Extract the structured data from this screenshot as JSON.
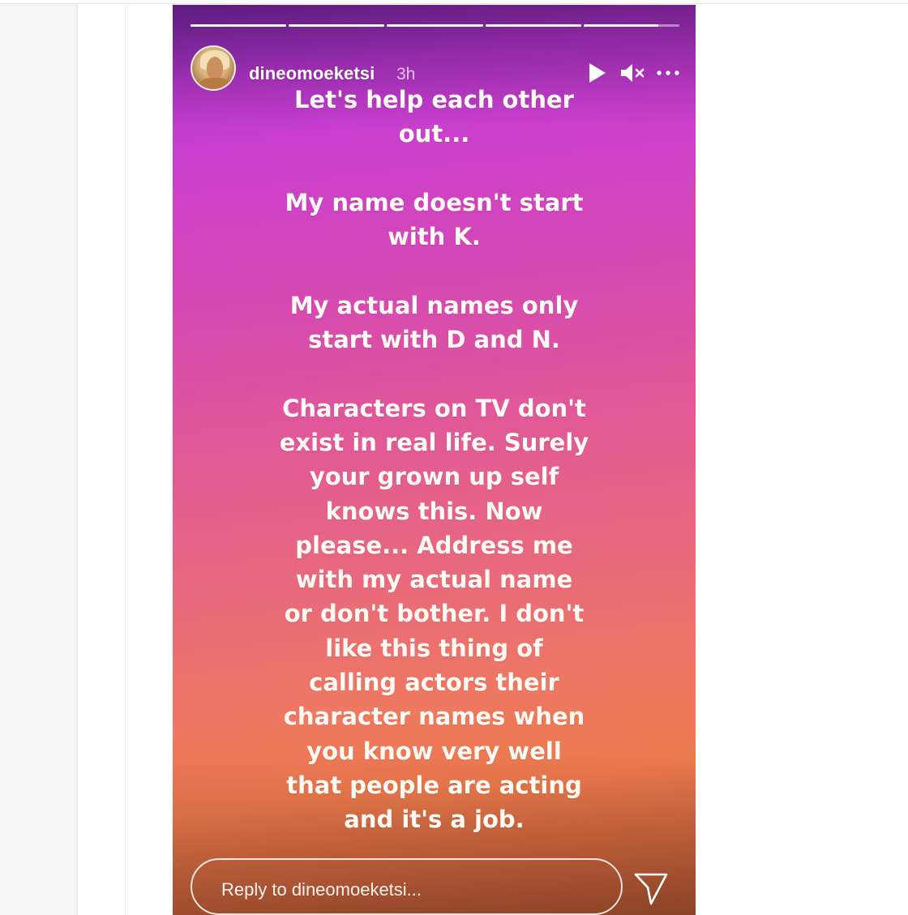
{
  "story": {
    "progress": [
      1,
      1,
      1,
      1,
      0.78
    ],
    "username": "dineomoeketsi",
    "time_ago": "3h",
    "controls": {
      "play_icon": "play-icon",
      "mute_icon": "muted-speaker-icon",
      "more_icon": "more-options-icon"
    },
    "text": {
      "p1": "Let's help each other\nout...",
      "p2": "My name doesn't start\nwith K.",
      "p3": "My actual names only\nstart with D and N.",
      "p4": "Characters on TV don't\nexist in real life. Surely\nyour grown up self\nknows this. Now\nplease... Address me\nwith my actual name\nor don't bother. I don't\nlike this thing of\ncalling actors their\ncharacter names when\nyou know very well\nthat people are acting\nand it's a job."
    },
    "reply": {
      "placeholder": "Reply to dineomoeketsi...",
      "value": ""
    },
    "send_icon": "paper-plane-icon",
    "colors": {
      "gradient_top": "#c93fcf",
      "gradient_mid": "#e0579a",
      "gradient_bottom": "#ec7a4d",
      "text": "#fffaf4"
    }
  }
}
